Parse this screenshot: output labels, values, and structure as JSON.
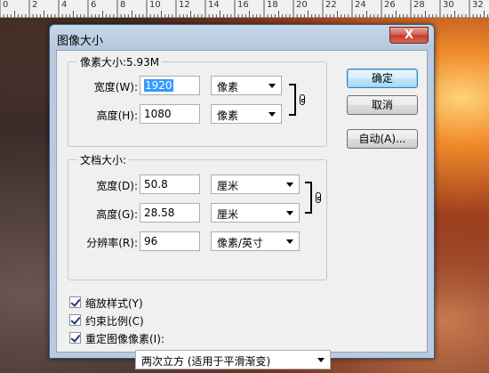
{
  "ruler": {
    "labels": [
      "0",
      "2",
      "4",
      "6",
      "8",
      "10",
      "12",
      "14",
      "16",
      "18",
      "20",
      "22",
      "24",
      "26",
      "28",
      "30",
      "32"
    ]
  },
  "dialog": {
    "title": "图像大小",
    "close_glyph": "X",
    "pixel_size": {
      "label": "像素大小:5.93M",
      "width_label": "宽度(W):",
      "width_value": "1920",
      "width_unit": "像素",
      "height_label": "高度(H):",
      "height_value": "1080",
      "height_unit": "像素"
    },
    "document_size": {
      "label": "文档大小:",
      "width_label": "宽度(D):",
      "width_value": "50.8",
      "width_unit": "厘米",
      "height_label": "高度(G):",
      "height_value": "28.58",
      "height_unit": "厘米",
      "resolution_label": "分辨率(R):",
      "resolution_value": "96",
      "resolution_unit": "像素/英寸"
    },
    "buttons": {
      "ok": "确定",
      "cancel": "取消",
      "auto": "自动(A)..."
    },
    "checkboxes": {
      "scale_styles": {
        "label": "缩放样式(Y)",
        "checked": true
      },
      "constrain_proportions": {
        "label": "约束比例(C)",
        "checked": true
      },
      "resample": {
        "label": "重定图像像素(I):",
        "checked": true
      }
    },
    "resample_method": "两次立方 (适用于平滑渐变)"
  }
}
